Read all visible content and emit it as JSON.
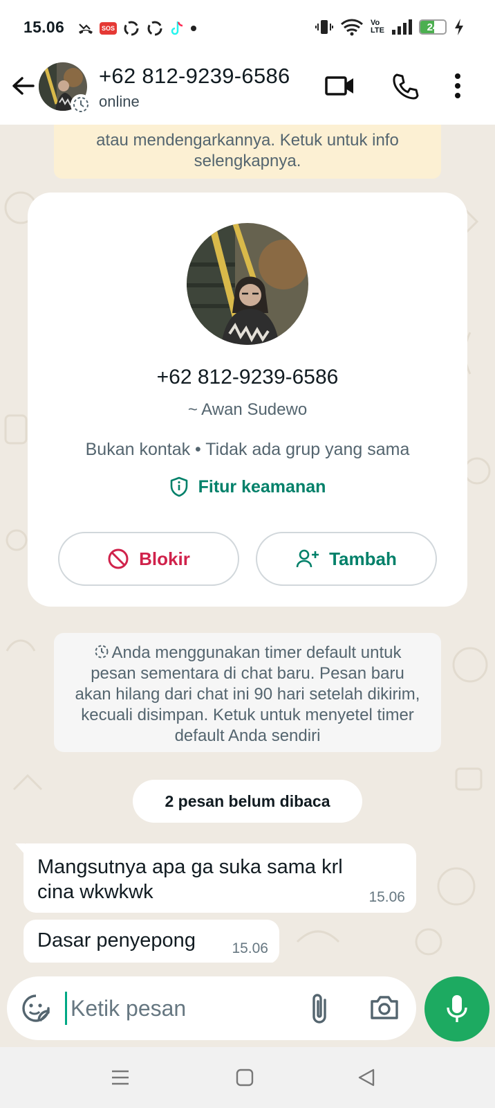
{
  "status_bar": {
    "time": "15.06",
    "battery_level": "24",
    "icons": [
      "missed-call-icon",
      "sos-icon",
      "sync-icon",
      "sync-icon",
      "tiktok-icon",
      "dot-icon",
      "vibrate-icon",
      "wifi-icon",
      "volte-icon",
      "signal-icon",
      "battery-icon",
      "charging-icon"
    ],
    "sos_label": "SOS",
    "volte_label_top": "Vo",
    "volte_label_bottom": "LTE"
  },
  "header": {
    "title": "+62 812-9239-6586",
    "subtitle": "online"
  },
  "encryption_banner": {
    "line1": "atau mendengarkannya. Ketuk untuk info",
    "line2": "selengkapnya."
  },
  "profile_card": {
    "phone": "+62 812-9239-6586",
    "name": "~ Awan Sudewo",
    "info": "Bukan kontak • Tidak ada grup yang sama",
    "security_label": "Fitur keamanan",
    "block_label": "Blokir",
    "add_label": "Tambah"
  },
  "timer_notice": {
    "text": "Anda menggunakan timer default untuk pesan sementara di chat baru. Pesan baru akan hilang dari chat ini 90 hari setelah dikirim, kecuali disimpan. Ketuk untuk menyetel timer default Anda sendiri"
  },
  "unread_label": "2 pesan belum dibaca",
  "messages": [
    {
      "text": "Mangsutnya apa ga suka sama krl cina wkwkwk",
      "time": "15.06"
    },
    {
      "text": "Dasar penyepong",
      "time": "15.06"
    }
  ],
  "composer": {
    "placeholder": "Ketik pesan",
    "value": ""
  },
  "colors": {
    "accent": "#008069",
    "mic": "#1daa61",
    "block": "#d0224b",
    "chat_bg": "#efeae2",
    "banner_bg": "#fcf0d3"
  }
}
